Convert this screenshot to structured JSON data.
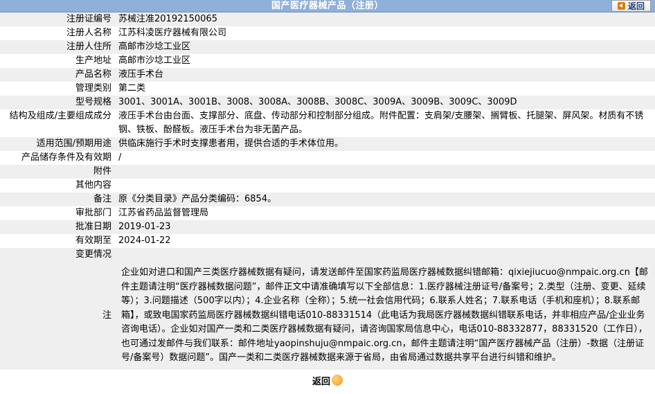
{
  "header": {
    "title": "国产医疗器械产品（注册）",
    "back_label": "返回"
  },
  "rows": [
    {
      "label": "注册证编号",
      "value": "苏械注准20192150065"
    },
    {
      "label": "注册人名称",
      "value": "江苏科凌医疗器械有限公司"
    },
    {
      "label": "注册人住所",
      "value": "高邮市沙埝工业区"
    },
    {
      "label": "生产地址",
      "value": "高邮市沙埝工业区"
    },
    {
      "label": "产品名称",
      "value": "液压手术台"
    },
    {
      "label": "管理类别",
      "value": "第二类"
    },
    {
      "label": "型号规格",
      "value": "3001、3001A、3001B、3008、3008A、3008B、3008C、3009A、3009B、3009C、3009D"
    },
    {
      "label": "结构及组成/主要组成成分",
      "value": "液压手术台由台面、支撑部分、底盘、传动部分和控制部分组成。附件配置：支肩架/支腰架、搁臂板、托腿架、屏风架。材质有不锈钢、铁板、酚醛板。液压手术台为非无菌产品。"
    },
    {
      "label": "适用范围/预期用途",
      "value": "供临床施行手术时支撑患者用，提供合适的手术体位用。"
    },
    {
      "label": "产品储存条件及有效期",
      "value": "/"
    },
    {
      "label": "附件",
      "value": ""
    },
    {
      "label": "其他内容",
      "value": ""
    },
    {
      "label": "备注",
      "value": "原《分类目录》产品分类编码：6854。"
    },
    {
      "label": "审批部门",
      "value": "江苏省药品监督管理局"
    },
    {
      "label": "批准日期",
      "value": "2019-01-23"
    },
    {
      "label": "有效期至",
      "value": "2024-01-22"
    },
    {
      "label": "变更情况",
      "value": ""
    }
  ],
  "note": {
    "label": "注",
    "text": "企业如对进口和国产三类医疗器械数据有疑问，请发送邮件至国家药监局医疗器械数据纠错邮箱：qixiejiucuo@nmpaic.org.cn【邮件主题请注明“医疗器械数据问题”，邮件正文中请准确填写以下全部信息：1.医疗器械注册证号/备案号；2.类型（注册、变更、延续等）；3.问题描述（500字以内）；4.企业名称（全称）；5.统一社会信用代码；6.联系人姓名；7.联系电话（手机和座机）；8.联系邮箱】，或致电国家药监局医疗器械数据纠错电话010-88331514（此电话为我局医疗器械数据纠错联系电话，并非相应产品/企业业务咨询电话）。企业如对国产一类和二类医疗器械数据有疑问，请咨询国家局信息中心，电话010-88332877，88331520（工作日），也可通过发邮件与我们联系：邮件地址yaopinshuju@nmpaic.org.cn，邮件主题请注明“国产医疗器械产品（注册）-数据（注册证号/备案号）数据问题”。国产一类和二类医疗器械数据来源于省局，由省局通过数据共享平台进行纠错和维护。"
  },
  "footer": {
    "back_label": "返回"
  }
}
